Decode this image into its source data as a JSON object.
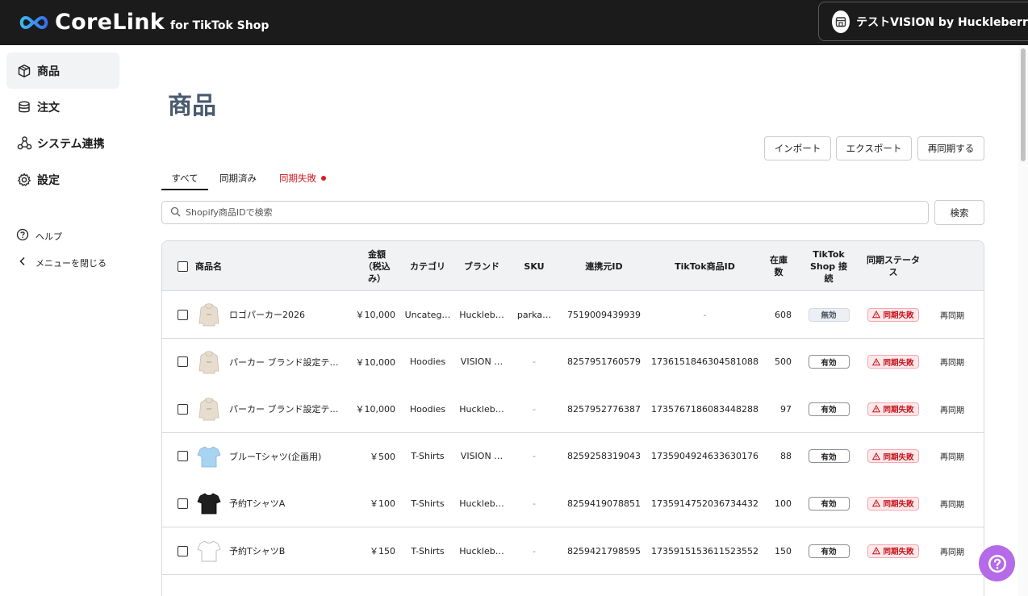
{
  "header": {
    "logo_main": "CoreLink",
    "logo_sub": "for TikTok Shop",
    "shop_name": "テストVISION by Huckleberry"
  },
  "sidebar": {
    "items": [
      {
        "label": "商品",
        "icon": "package-icon",
        "active": true
      },
      {
        "label": "注文",
        "icon": "database-icon",
        "active": false
      },
      {
        "label": "システム連携",
        "icon": "integration-icon",
        "active": false
      },
      {
        "label": "設定",
        "icon": "gear-icon",
        "active": false
      }
    ],
    "help_label": "ヘルプ",
    "close_menu_label": "メニューを閉じる"
  },
  "page": {
    "title": "商品",
    "actions": {
      "import": "インポート",
      "export": "エクスポート",
      "resync": "再同期する"
    },
    "tabs": [
      {
        "label": "すべて",
        "active": true
      },
      {
        "label": "同期済み",
        "active": false
      },
      {
        "label": "同期失敗",
        "active": false,
        "error": true
      }
    ],
    "search": {
      "placeholder": "Shopify商品IDで検索",
      "button": "検索"
    }
  },
  "table": {
    "headers": {
      "name": "商品名",
      "price": "金額（税込み）",
      "category": "カテゴリ",
      "brand": "ブランド",
      "sku": "SKU",
      "source_id": "連携元ID",
      "tiktok_id": "TikTok商品ID",
      "stock": "在庫数",
      "connection": "TikTok Shop 接続",
      "sync_status": "同期ステータス"
    },
    "rows": [
      {
        "thumb": "hoodie",
        "name": "ロゴパーカー2026",
        "price": "￥10,000",
        "category": "Uncateg…",
        "brand": "Huckleb…",
        "sku": "parka…",
        "source_id": "7519009439939",
        "tiktok_id": "-",
        "stock": "608",
        "connection": "無効",
        "connection_on": false,
        "status": "同期失敗",
        "action": "再同期"
      },
      {
        "thumb": "hoodie",
        "name": "パーカー ブランド設定テ…",
        "price": "￥10,000",
        "category": "Hoodies",
        "brand": "VISION …",
        "sku": "-",
        "source_id": "8257951760579",
        "tiktok_id": "1736151846304581088",
        "stock": "500",
        "connection": "有効",
        "connection_on": true,
        "status": "同期失敗",
        "action": "再同期"
      },
      {
        "thumb": "hoodie",
        "name": "パーカー ブランド設定テ…",
        "price": "￥10,000",
        "category": "Hoodies",
        "brand": "Huckleb…",
        "sku": "-",
        "source_id": "8257952776387",
        "tiktok_id": "1735767186083448288",
        "stock": "97",
        "connection": "有効",
        "connection_on": true,
        "status": "同期失敗",
        "action": "再同期"
      },
      {
        "thumb": "tshirt-blue",
        "name": "ブルーTシャツ(企画用)",
        "price": "￥500",
        "category": "T-Shirts",
        "brand": "VISION …",
        "sku": "-",
        "source_id": "8259258319043",
        "tiktok_id": "1735904924633630176",
        "stock": "88",
        "connection": "有効",
        "connection_on": true,
        "status": "同期失敗",
        "action": "再同期"
      },
      {
        "thumb": "tshirt-black",
        "name": "予約TシャツA",
        "price": "￥100",
        "category": "T-Shirts",
        "brand": "Huckleb…",
        "sku": "-",
        "source_id": "8259419078851",
        "tiktok_id": "1735914752036734432",
        "stock": "100",
        "connection": "有効",
        "connection_on": true,
        "status": "同期失敗",
        "action": "再同期"
      },
      {
        "thumb": "tshirt-white",
        "name": "予約TシャツB",
        "price": "￥150",
        "category": "T-Shirts",
        "brand": "Huckleb…",
        "sku": "-",
        "source_id": "8259421798595",
        "tiktok_id": "1735915153611523552",
        "stock": "150",
        "connection": "有効",
        "connection_on": true,
        "status": "同期失敗",
        "action": "再同期"
      }
    ]
  },
  "colors": {
    "header_bg": "#1b1b1b",
    "title": "#4a5a6e",
    "error": "#c3131c",
    "help_fab": "#b56ae8"
  }
}
